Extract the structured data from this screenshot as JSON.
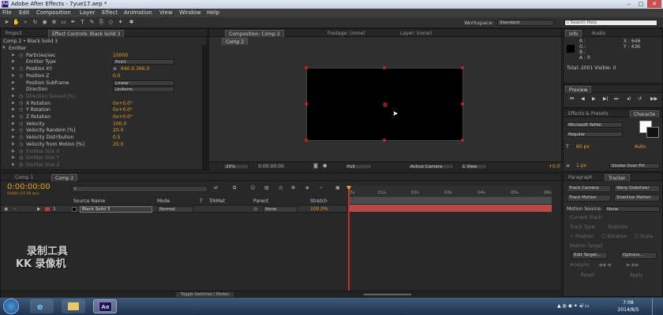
{
  "window": {
    "title": "Adobe After Effects - 7yue17.aep *"
  },
  "menu": [
    "File",
    "Edit",
    "Composition",
    "Layer",
    "Effect",
    "Animation",
    "View",
    "Window",
    "Help"
  ],
  "toolbar": {
    "workspace_label": "Workspace:",
    "workspace_value": "Standard",
    "search_placeholder": "Search Help"
  },
  "left_panel": {
    "tab_project": "Project",
    "tab_effect_controls": "Effect Controls: Black Solid 3",
    "breadcrumb": "Comp 2 • Black Solid 3",
    "properties": [
      {
        "label": "Emitter",
        "value": "",
        "indent": 0,
        "kind": "group"
      },
      {
        "label": "Particles/sec",
        "value": "10000",
        "indent": 1,
        "kind": "value"
      },
      {
        "label": "Emitter Type",
        "value": "Point",
        "indent": 1,
        "kind": "select"
      },
      {
        "label": "Position XY",
        "value": "640.0,366.0",
        "indent": 1,
        "kind": "point"
      },
      {
        "label": "Position Z",
        "value": "0.0",
        "indent": 1,
        "kind": "value"
      },
      {
        "label": "Position Subframe",
        "value": "Linear",
        "indent": 1,
        "kind": "select"
      },
      {
        "label": "Direction",
        "value": "Uniform",
        "indent": 1,
        "kind": "select"
      },
      {
        "label": "Direction Spread [%]",
        "value": "",
        "indent": 1,
        "kind": "dim"
      },
      {
        "label": "X Rotation",
        "value": "0x+0.0°",
        "indent": 1,
        "kind": "value"
      },
      {
        "label": "Y Rotation",
        "value": "0x+0.0°",
        "indent": 1,
        "kind": "value"
      },
      {
        "label": "Z Rotation",
        "value": "0x+0.0°",
        "indent": 1,
        "kind": "value"
      },
      {
        "label": "Velocity",
        "value": "100.0",
        "indent": 1,
        "kind": "value"
      },
      {
        "label": "Velocity Random [%]",
        "value": "20.0",
        "indent": 1,
        "kind": "value"
      },
      {
        "label": "Velocity Distribution",
        "value": "0.5",
        "indent": 1,
        "kind": "value"
      },
      {
        "label": "Velocity from Motion [%]",
        "value": "20.0",
        "indent": 1,
        "kind": "value"
      },
      {
        "label": "Emitter Size X",
        "value": "",
        "indent": 1,
        "kind": "dim"
      },
      {
        "label": "Emitter Size Y",
        "value": "",
        "indent": 1,
        "kind": "dim"
      },
      {
        "label": "Emitter Size Z",
        "value": "",
        "indent": 1,
        "kind": "dim"
      }
    ]
  },
  "composition": {
    "tab_composition": "Composition: Comp 2",
    "tab_footage": "Footage: (none)",
    "tab_layer": "Layer: (none)",
    "sub_tab": "Comp 2",
    "zoom": "25%",
    "timecode": "0:00:00:00",
    "resolution": "Full",
    "camera": "Active Camera",
    "views": "1 View",
    "exposure": "+0.0"
  },
  "info": {
    "tab_info": "Info",
    "tab_audio": "Audio",
    "r": "R :",
    "g": "G :",
    "b": "B :",
    "a": "A : 0",
    "x": "X : 646",
    "y": "Y : 436",
    "total": "Total: 2001  Visible: 0"
  },
  "preview": {
    "tab": "Preview"
  },
  "effects": {
    "tab_effects": "Effects & Presets",
    "tab_character": "Characte"
  },
  "character": {
    "font": "Microsoft YaHei",
    "style": "Regular",
    "size": "60 px",
    "tracking": "Auto",
    "stroke_size": "1 px",
    "stroke_mode": "Stroke Over Fill"
  },
  "paragraph": {
    "tab_paragraph": "Paragraph",
    "tab_tracker": "Tracker"
  },
  "tracker": {
    "btn_track_camera": "Track Camera",
    "btn_warp": "Warp Stabilizer",
    "btn_track_motion": "Track Motion",
    "btn_stabilize": "Stabilize Motion",
    "motion_source_label": "Motion Source:",
    "motion_source_value": "None",
    "current_track_label": "Current Track:",
    "track_type_label": "Track Type:",
    "track_type_value": "Stabilize",
    "position_label": "Position",
    "rotation_label": "Rotation",
    "scale_label": "Scale",
    "motion_target_label": "Motion Target:",
    "edit_target": "Edit Target...",
    "options": "Options...",
    "analyze_label": "Analyze:",
    "reset": "Reset",
    "apply": "Apply"
  },
  "timeline": {
    "tab_comp1": "Comp 1",
    "tab_comp2": "Comp 2",
    "timecode": "0:00:00:00",
    "fps": "00000 (25.00 fps)",
    "col_source": "Source Name",
    "col_mode": "Mode",
    "col_t": "T",
    "col_trkmat": "TrkMat",
    "col_parent": "Parent",
    "col_stretch": "Stretch",
    "layer_num": "1",
    "layer_name": "Black Solid 3",
    "layer_mode": "Normal",
    "layer_parent": "None",
    "layer_stretch": "100.0%",
    "ticks": [
      "0s",
      "01s",
      "02s",
      "03s",
      "04s",
      "05s",
      "06s"
    ],
    "toggle_label": "Toggle Switches / Modes"
  },
  "watermark": {
    "line1": "录制工具",
    "line2": "KK 录像机"
  },
  "taskbar": {
    "time": "7:08",
    "date": "2014/8/5",
    "ae_label": "Ae"
  }
}
